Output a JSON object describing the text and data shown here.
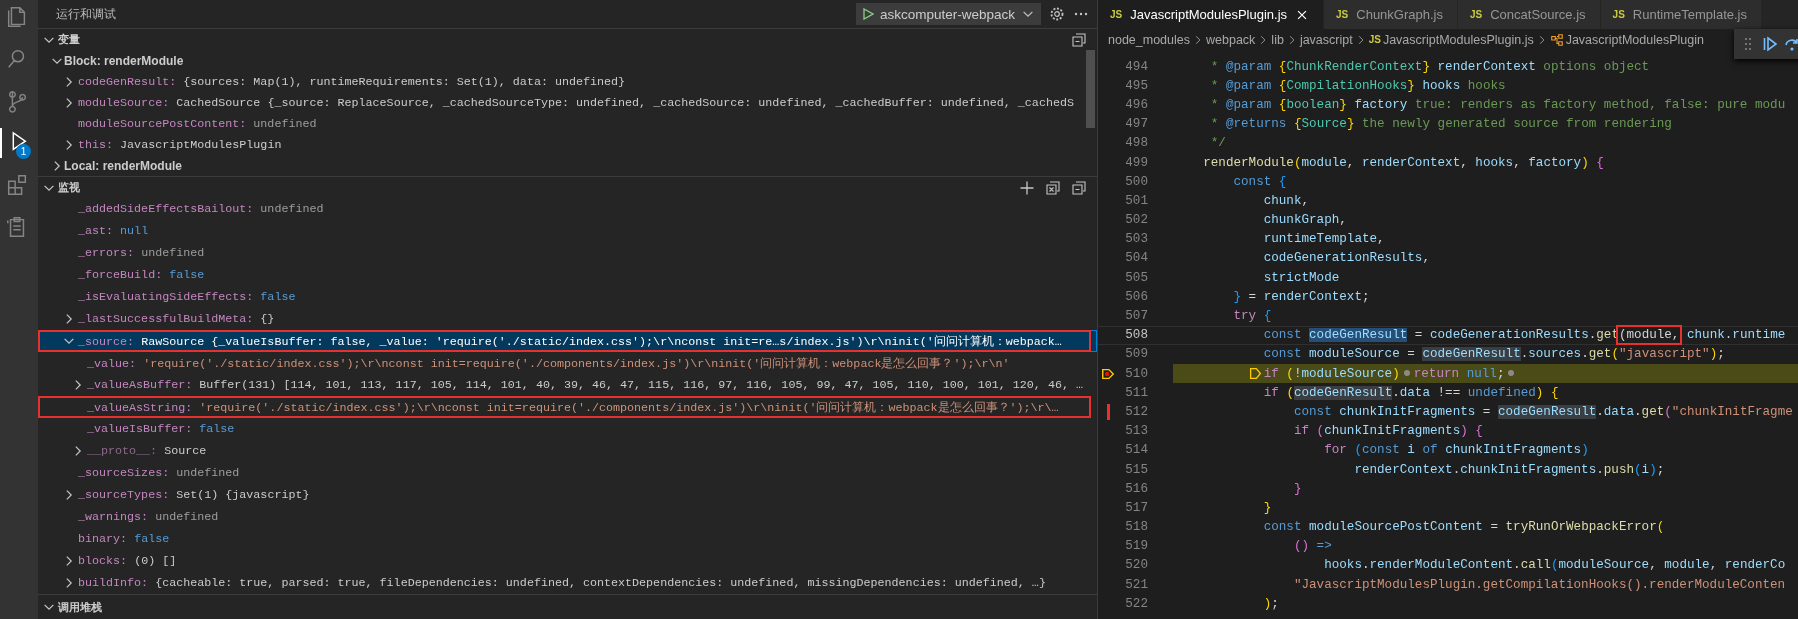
{
  "activity_bar": {
    "items": [
      {
        "selected": false
      },
      {
        "selected": false
      },
      {
        "selected": false
      },
      {
        "selected": true,
        "badge": "1"
      },
      {
        "selected": false
      },
      {
        "selected": false
      }
    ]
  },
  "sidebar": {
    "title": "运行和调试",
    "launch_config": "askcomputer-webpack",
    "variables": {
      "title": "变量",
      "expanded": true,
      "scopes": [
        {
          "name": "Block: renderModule",
          "expanded": true,
          "items": [
            {
              "name": "codeGenResult:",
              "value": "{sources: Map(1), runtimeRequirements: Set(1), data: undefined}",
              "kind": "object",
              "expanded": false
            },
            {
              "name": "moduleSource:",
              "value": "CachedSource {_source: ReplaceSource, _cachedSourceType: undefined, _cachedSource: undefined, _cachedBuffer: undefined, _cachedS",
              "kind": "object",
              "expanded": false
            },
            {
              "name": "moduleSourcePostContent:",
              "value": "undefined",
              "kind": "undef"
            },
            {
              "name": "this:",
              "value": "JavascriptModulesPlugin",
              "kind": "object",
              "expanded": false
            }
          ]
        },
        {
          "name": "Local: renderModule",
          "expanded": false
        }
      ]
    },
    "watch": {
      "title": "监视",
      "expanded": true,
      "items": [
        {
          "name": "_addedSideEffectsBailout:",
          "value": "undefined",
          "kind": "undef",
          "selected": false,
          "annotated": false
        },
        {
          "name": "_ast:",
          "value": "null",
          "kind": "literal",
          "selected": false,
          "annotated": false
        },
        {
          "name": "_errors:",
          "value": "undefined",
          "kind": "undef",
          "selected": false,
          "annotated": false
        },
        {
          "name": "_forceBuild:",
          "value": "false",
          "kind": "literal",
          "selected": false,
          "annotated": false
        },
        {
          "name": "_isEvaluatingSideEffects:",
          "value": "false",
          "kind": "literal",
          "selected": false,
          "annotated": false
        },
        {
          "name": "_lastSuccessfulBuildMeta:",
          "value": "{}",
          "kind": "object",
          "expanded": false,
          "selected": false,
          "annotated": false
        },
        {
          "name": "_source:",
          "value": "RawSource {_valueIsBuffer: false, _value: 'require('./static/index.css');\\r\\nconst init=re…s/index.js')\\r\\ninit('问问计算机：webpack…",
          "kind": "object",
          "expanded": true,
          "selected": true,
          "annotated": true,
          "children": [
            {
              "name": "_value:",
              "value": "'require('./static/index.css');\\r\\nconst init=require('./components/index.js')\\r\\ninit('问问计算机：webpack是怎么回事？');\\r\\n'",
              "kind": "string",
              "selected": false,
              "annotated": false
            },
            {
              "name": "_valueAsBuffer:",
              "value": "Buffer(131) [114, 101, 113, 117, 105, 114, 101, 40, 39, 46, 47, 115, 116, 97, 116, 105, 99, 47, 105, 110, 100, 101, 120, 46, …",
              "kind": "object",
              "expanded": false,
              "selected": false,
              "annotated": false
            },
            {
              "name": "_valueAsString:",
              "value": "'require('./static/index.css');\\r\\nconst init=require('./components/index.js')\\r\\ninit('问问计算机：webpack是怎么回事？');\\r\\…",
              "kind": "string",
              "selected": false,
              "annotated": true
            },
            {
              "name": "_valueIsBuffer:",
              "value": "false",
              "kind": "literal",
              "selected": false,
              "annotated": false
            },
            {
              "name": "__proto__:",
              "value": "Source",
              "kind": "prototype",
              "expanded": false,
              "selected": false,
              "annotated": false
            }
          ]
        },
        {
          "name": "_sourceSizes:",
          "value": "undefined",
          "kind": "undef",
          "selected": false,
          "annotated": false
        },
        {
          "name": "_sourceTypes:",
          "value": "Set(1) {javascript}",
          "kind": "object",
          "expanded": false,
          "selected": false,
          "annotated": false
        },
        {
          "name": "_warnings:",
          "value": "undefined",
          "kind": "undef",
          "selected": false,
          "annotated": false
        },
        {
          "name": "binary:",
          "value": "false",
          "kind": "literal",
          "selected": false,
          "annotated": false
        },
        {
          "name": "blocks:",
          "value": "(0) []",
          "kind": "object",
          "expanded": false,
          "selected": false,
          "annotated": false
        },
        {
          "name": "buildInfo:",
          "value": "{cacheable: true, parsed: true, fileDependencies: undefined, contextDependencies: undefined, missingDependencies: undefined, …}",
          "kind": "object",
          "expanded": false,
          "selected": false,
          "annotated": false
        }
      ]
    },
    "call_stack": {
      "title": "调用堆栈",
      "expanded": true
    }
  },
  "editor": {
    "tabs": [
      {
        "badge": "JS",
        "label": "JavascriptModulesPlugin.js",
        "selected": true
      },
      {
        "badge": "JS",
        "label": "ChunkGraph.js",
        "selected": false
      },
      {
        "badge": "JS",
        "label": "ConcatSource.js",
        "selected": false
      },
      {
        "badge": "JS",
        "label": "RuntimeTemplate.js",
        "selected": false
      }
    ],
    "breadcrumbs": [
      {
        "label": "node_modules",
        "kind": "folder"
      },
      {
        "label": "webpack",
        "kind": "folder"
      },
      {
        "label": "lib",
        "kind": "folder"
      },
      {
        "label": "javascript",
        "kind": "folder"
      },
      {
        "label": "JavascriptModulesPlugin.js",
        "kind": "file",
        "badge": "JS"
      },
      {
        "label": "JavascriptModulesPlugin",
        "kind": "symbol"
      }
    ],
    "lines": [
      {
        "number": "494",
        "kind": "normal",
        "tokens": [
          {
            "text": "     *",
            "kind": "comment"
          },
          {
            "text": " @param",
            "kind": "doctag"
          },
          {
            "text": " {",
            "kind": "bracket1"
          },
          {
            "text": "ChunkRenderContext",
            "kind": "type"
          },
          {
            "text": "}",
            "kind": "bracket1"
          },
          {
            "text": " renderContext",
            "kind": "param"
          },
          {
            "text": " options object",
            "kind": "comment"
          }
        ]
      },
      {
        "number": "495",
        "kind": "normal",
        "tokens": [
          {
            "text": "     *",
            "kind": "comment"
          },
          {
            "text": " @param",
            "kind": "doctag"
          },
          {
            "text": " {",
            "kind": "bracket1"
          },
          {
            "text": "CompilationHooks",
            "kind": "type"
          },
          {
            "text": "}",
            "kind": "bracket1"
          },
          {
            "text": " hooks",
            "kind": "param"
          },
          {
            "text": " hooks",
            "kind": "comment"
          }
        ]
      },
      {
        "number": "496",
        "kind": "normal",
        "tokens": [
          {
            "text": "     *",
            "kind": "comment"
          },
          {
            "text": " @param",
            "kind": "doctag"
          },
          {
            "text": " {",
            "kind": "bracket1"
          },
          {
            "text": "boolean",
            "kind": "type"
          },
          {
            "text": "}",
            "kind": "bracket1"
          },
          {
            "text": " factory",
            "kind": "param"
          },
          {
            "text": " true: renders as factory method, false: pure modu",
            "kind": "comment"
          }
        ]
      },
      {
        "number": "497",
        "kind": "normal",
        "tokens": [
          {
            "text": "     *",
            "kind": "comment"
          },
          {
            "text": " @returns",
            "kind": "doctag"
          },
          {
            "text": " {",
            "kind": "bracket1"
          },
          {
            "text": "Source",
            "kind": "type"
          },
          {
            "text": "}",
            "kind": "bracket1"
          },
          {
            "text": " the newly generated source from rendering",
            "kind": "comment"
          }
        ]
      },
      {
        "number": "498",
        "kind": "normal",
        "tokens": [
          {
            "text": "     */",
            "kind": "comment"
          }
        ]
      },
      {
        "number": "499",
        "kind": "normal",
        "tokens": [
          {
            "text": "    renderModule",
            "kind": "fn"
          },
          {
            "text": "(",
            "kind": "bracket1"
          },
          {
            "text": "module",
            "kind": "param"
          },
          {
            "text": ", ",
            "kind": "plain"
          },
          {
            "text": "renderContext",
            "kind": "param"
          },
          {
            "text": ", ",
            "kind": "plain"
          },
          {
            "text": "hooks",
            "kind": "param"
          },
          {
            "text": ", ",
            "kind": "plain"
          },
          {
            "text": "factory",
            "kind": "param"
          },
          {
            "text": ")",
            "kind": "bracket1"
          },
          {
            "text": " {",
            "kind": "bracket2"
          }
        ]
      },
      {
        "number": "500",
        "kind": "normal",
        "tokens": [
          {
            "text": "        const",
            "kind": "kw"
          },
          {
            "text": " {",
            "kind": "bracket3"
          }
        ]
      },
      {
        "number": "501",
        "kind": "normal",
        "tokens": [
          {
            "text": "            chunk",
            "kind": "var"
          },
          {
            "text": ",",
            "kind": "plain"
          }
        ]
      },
      {
        "number": "502",
        "kind": "normal",
        "tokens": [
          {
            "text": "            chunkGraph",
            "kind": "var"
          },
          {
            "text": ",",
            "kind": "plain"
          }
        ]
      },
      {
        "number": "503",
        "kind": "normal",
        "tokens": [
          {
            "text": "            runtimeTemplate",
            "kind": "var"
          },
          {
            "text": ",",
            "kind": "plain"
          }
        ]
      },
      {
        "number": "504",
        "kind": "normal",
        "tokens": [
          {
            "text": "            codeGenerationResults",
            "kind": "var"
          },
          {
            "text": ",",
            "kind": "plain"
          }
        ]
      },
      {
        "number": "505",
        "kind": "normal",
        "tokens": [
          {
            "text": "            strictMode",
            "kind": "var"
          }
        ]
      },
      {
        "number": "506",
        "kind": "normal",
        "tokens": [
          {
            "text": "        }",
            "kind": "bracket3"
          },
          {
            "text": " = ",
            "kind": "plain"
          },
          {
            "text": "renderContext",
            "kind": "var"
          },
          {
            "text": ";",
            "kind": "plain"
          }
        ]
      },
      {
        "number": "507",
        "kind": "normal",
        "tokens": [
          {
            "text": "        try",
            "kind": "ctrl"
          },
          {
            "text": " {",
            "kind": "bracket3"
          }
        ]
      },
      {
        "number": "508",
        "kind": "cursor",
        "tokens": [
          {
            "text": "            const ",
            "kind": "kw"
          },
          {
            "text": "codeGenResult",
            "kind": "sel"
          },
          {
            "text": " = ",
            "kind": "plain"
          },
          {
            "text": "codeGenerationResults",
            "kind": "var"
          },
          {
            "text": ".",
            "kind": "plain"
          },
          {
            "text": "get",
            "kind": "fn"
          },
          {
            "text": "(module,",
            "kind": "box"
          },
          {
            "text": " chunk",
            "kind": "var"
          },
          {
            "text": ".",
            "kind": "plain"
          },
          {
            "text": "runtime",
            "kind": "var"
          }
        ]
      },
      {
        "number": "509",
        "kind": "normal",
        "tokens": [
          {
            "text": "            const ",
            "kind": "kw"
          },
          {
            "text": "moduleSource",
            "kind": "var"
          },
          {
            "text": " = ",
            "kind": "plain"
          },
          {
            "text": "codeGenResult",
            "kind": "hl"
          },
          {
            "text": ".",
            "kind": "plain"
          },
          {
            "text": "sources",
            "kind": "var"
          },
          {
            "text": ".",
            "kind": "plain"
          },
          {
            "text": "get",
            "kind": "fn"
          },
          {
            "text": "(",
            "kind": "bracket1"
          },
          {
            "text": "\"javascript\"",
            "kind": "str"
          },
          {
            "text": ")",
            "kind": "bracket1"
          },
          {
            "text": ";",
            "kind": "plain"
          }
        ]
      },
      {
        "number": "510",
        "kind": "paused",
        "tokens": [
          {
            "kind": "frame"
          },
          {
            "text": "if ",
            "kind": "ctrl"
          },
          {
            "text": "(",
            "kind": "bracket1"
          },
          {
            "text": "!",
            "kind": "plain"
          },
          {
            "text": "moduleSource",
            "kind": "var"
          },
          {
            "text": ")",
            "kind": "bracket1"
          },
          {
            "kind": "bp"
          },
          {
            "text": "return ",
            "kind": "ctrl"
          },
          {
            "text": "null",
            "kind": "kw"
          },
          {
            "text": ";",
            "kind": "plain"
          },
          {
            "kind": "bp"
          }
        ]
      },
      {
        "number": "511",
        "kind": "normal",
        "tokens": [
          {
            "text": "            if ",
            "kind": "ctrl"
          },
          {
            "text": "(",
            "kind": "bracket1"
          },
          {
            "text": "codeGenResult",
            "kind": "hl"
          },
          {
            "text": ".",
            "kind": "plain"
          },
          {
            "text": "data",
            "kind": "var"
          },
          {
            "text": " !== ",
            "kind": "plain"
          },
          {
            "text": "undefined",
            "kind": "kw"
          },
          {
            "text": ")",
            "kind": "bracket1"
          },
          {
            "text": " {",
            "kind": "bracket1"
          }
        ]
      },
      {
        "number": "512",
        "kind": "annotated",
        "tokens": [
          {
            "text": "                const ",
            "kind": "kw"
          },
          {
            "text": "chunkInitFragments",
            "kind": "var"
          },
          {
            "text": " = ",
            "kind": "plain"
          },
          {
            "text": "codeGenResult",
            "kind": "hl"
          },
          {
            "text": ".",
            "kind": "plain"
          },
          {
            "text": "data",
            "kind": "var"
          },
          {
            "text": ".",
            "kind": "plain"
          },
          {
            "text": "get",
            "kind": "fn"
          },
          {
            "text": "(",
            "kind": "bracket2"
          },
          {
            "text": "\"chunkInitFragme",
            "kind": "str"
          }
        ]
      },
      {
        "number": "513",
        "kind": "normal",
        "tokens": [
          {
            "text": "                if ",
            "kind": "ctrl"
          },
          {
            "text": "(",
            "kind": "bracket2"
          },
          {
            "text": "chunkInitFragments",
            "kind": "var"
          },
          {
            "text": ")",
            "kind": "bracket2"
          },
          {
            "text": " {",
            "kind": "bracket2"
          }
        ]
      },
      {
        "number": "514",
        "kind": "normal",
        "tokens": [
          {
            "text": "                    for ",
            "kind": "ctrl"
          },
          {
            "text": "(",
            "kind": "bracket3"
          },
          {
            "text": "const ",
            "kind": "kw"
          },
          {
            "text": "i ",
            "kind": "var"
          },
          {
            "text": "of ",
            "kind": "kw"
          },
          {
            "text": "chunkInitFragments",
            "kind": "var"
          },
          {
            "text": ")",
            "kind": "bracket3"
          }
        ]
      },
      {
        "number": "515",
        "kind": "normal",
        "tokens": [
          {
            "text": "                        renderContext",
            "kind": "var"
          },
          {
            "text": ".",
            "kind": "plain"
          },
          {
            "text": "chunkInitFragments",
            "kind": "var"
          },
          {
            "text": ".",
            "kind": "plain"
          },
          {
            "text": "push",
            "kind": "fn"
          },
          {
            "text": "(",
            "kind": "bracket3"
          },
          {
            "text": "i",
            "kind": "var"
          },
          {
            "text": ")",
            "kind": "bracket3"
          },
          {
            "text": ";",
            "kind": "plain"
          }
        ]
      },
      {
        "number": "516",
        "kind": "normal",
        "tokens": [
          {
            "text": "                }",
            "kind": "bracket2"
          }
        ]
      },
      {
        "number": "517",
        "kind": "normal",
        "tokens": [
          {
            "text": "            }",
            "kind": "bracket1"
          }
        ]
      },
      {
        "number": "518",
        "kind": "normal",
        "tokens": [
          {
            "text": "            const ",
            "kind": "kw"
          },
          {
            "text": "moduleSourcePostContent",
            "kind": "var"
          },
          {
            "text": " = ",
            "kind": "plain"
          },
          {
            "text": "tryRunOrWebpackError",
            "kind": "fn"
          },
          {
            "text": "(",
            "kind": "bracket1"
          }
        ]
      },
      {
        "number": "519",
        "kind": "normal",
        "tokens": [
          {
            "text": "                ()",
            "kind": "bracket2"
          },
          {
            "text": " =>",
            "kind": "kw"
          }
        ]
      },
      {
        "number": "520",
        "kind": "normal",
        "tokens": [
          {
            "text": "                    hooks",
            "kind": "var"
          },
          {
            "text": ".",
            "kind": "plain"
          },
          {
            "text": "renderModuleContent",
            "kind": "var"
          },
          {
            "text": ".",
            "kind": "plain"
          },
          {
            "text": "call",
            "kind": "fn"
          },
          {
            "text": "(",
            "kind": "bracket3"
          },
          {
            "text": "moduleSource",
            "kind": "var"
          },
          {
            "text": ", ",
            "kind": "plain"
          },
          {
            "text": "module",
            "kind": "var"
          },
          {
            "text": ", ",
            "kind": "plain"
          },
          {
            "text": "renderCo",
            "kind": "var"
          }
        ]
      },
      {
        "number": "521",
        "kind": "normal",
        "tokens": [
          {
            "text": "                \"JavascriptModulesPlugin.getCompilationHooks().renderModuleConten",
            "kind": "str"
          }
        ]
      },
      {
        "number": "522",
        "kind": "normal",
        "tokens": [
          {
            "text": "            )",
            "kind": "bracket1"
          },
          {
            "text": ";",
            "kind": "plain"
          }
        ]
      }
    ]
  }
}
